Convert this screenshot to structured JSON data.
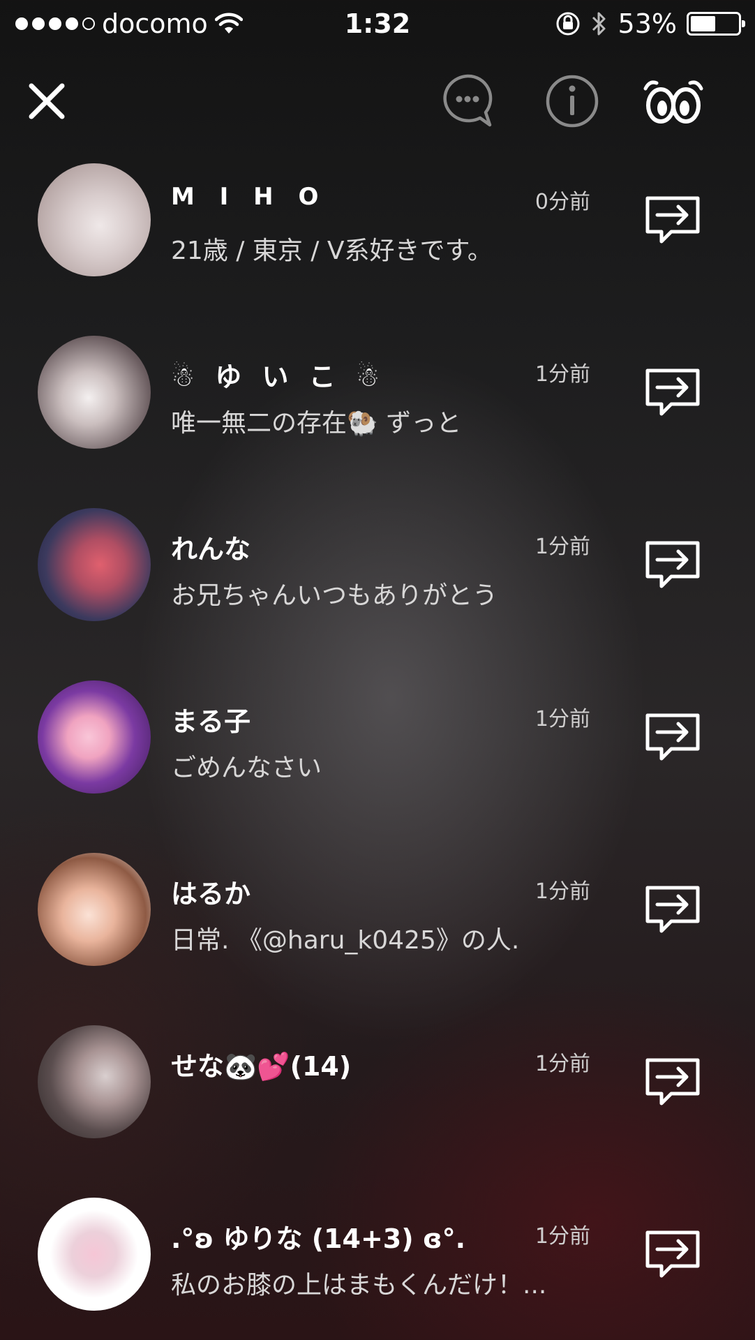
{
  "status_bar": {
    "carrier": "docomo",
    "time": "1:32",
    "battery": "53%",
    "battery_level": 0.53,
    "signal_bars_filled": 4,
    "signal_bars_total": 5
  },
  "top_bar": {
    "icons": [
      "close-icon",
      "chat-bubble-icon",
      "info-icon",
      "eyes-icon"
    ]
  },
  "users": [
    {
      "name": "M I H O",
      "time": "0分前",
      "message": "21歳 / 東京 / V系好きです。"
    },
    {
      "name": "☃ ゆ い こ ☃",
      "time": "1分前",
      "message": "唯一無二の存在🐏 ずっと"
    },
    {
      "name": "れんな",
      "time": "1分前",
      "message": "お兄ちゃんいつもありがとう"
    },
    {
      "name": "まる子",
      "time": "1分前",
      "message": "ごめんなさい"
    },
    {
      "name": "はるか",
      "time": "1分前",
      "message": "日常. 《@haru_k0425》の人."
    },
    {
      "name": "せな🐼💕(14)",
      "time": "1分前",
      "message": ""
    },
    {
      "name": ".°ʚ ゆりな (14+3) ɞ°.",
      "time": "1分前",
      "message": "私のお膝の上はまもくんだけ！..."
    }
  ]
}
